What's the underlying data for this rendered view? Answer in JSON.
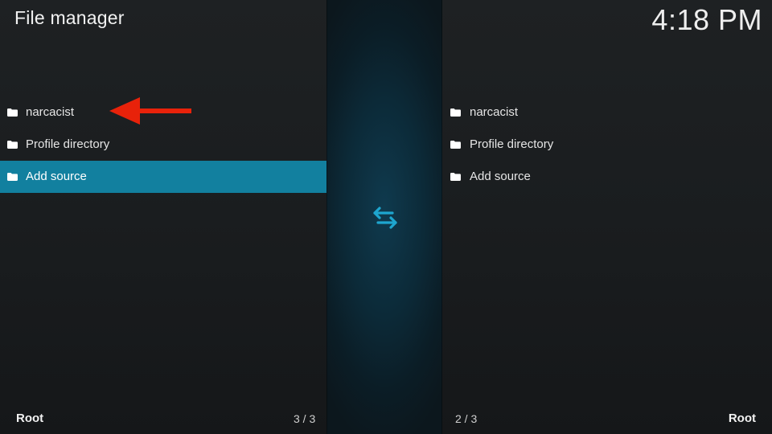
{
  "header": {
    "title": "File manager",
    "clock": "4:18 PM"
  },
  "left_pane": {
    "items": [
      {
        "label": "narcacist",
        "icon": "folder-icon"
      },
      {
        "label": "Profile directory",
        "icon": "folder-icon"
      },
      {
        "label": "Add source",
        "icon": "folder-icon",
        "selected": true
      }
    ],
    "footer_path": "Root",
    "footer_count": "3 / 3"
  },
  "right_pane": {
    "items": [
      {
        "label": "narcacist",
        "icon": "folder-icon"
      },
      {
        "label": "Profile directory",
        "icon": "folder-icon"
      },
      {
        "label": "Add source",
        "icon": "folder-icon"
      }
    ],
    "footer_path": "Root",
    "footer_count": "2 / 3"
  },
  "divider": {
    "icon": "swap-arrows-icon"
  },
  "annotation": {
    "icon": "red-arrow-left-icon",
    "color": "#e8220a"
  },
  "colors": {
    "selection": "#12809f",
    "accent": "#1ea6cf"
  }
}
